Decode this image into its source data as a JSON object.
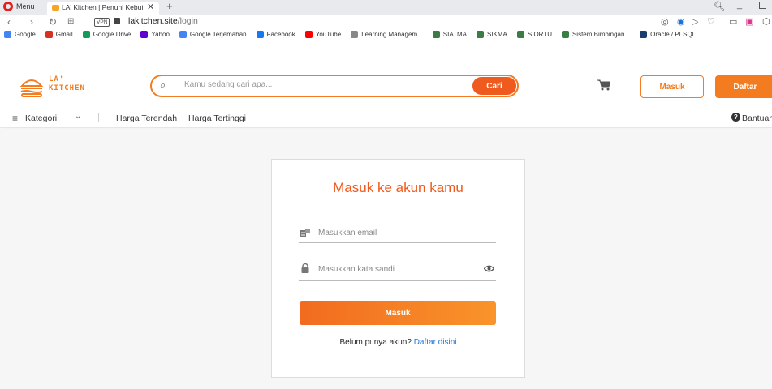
{
  "browser": {
    "menu_label": "Menu",
    "tab_title": "LA' Kitchen | Penuhi Kebutuh",
    "tab_close": "✕",
    "new_tab": "+",
    "vpn_badge": "VPN",
    "url_host": "lakitchen.site",
    "url_path": "/login",
    "bookmarks": [
      {
        "label": "Google",
        "icon": "google-icon",
        "color": "#4285f4"
      },
      {
        "label": "Gmail",
        "icon": "gmail-icon",
        "color": "#d93025"
      },
      {
        "label": "Google Drive",
        "icon": "drive-icon",
        "color": "#0f9d58"
      },
      {
        "label": "Yahoo",
        "icon": "yahoo-icon",
        "color": "#6001d2"
      },
      {
        "label": "Google Terjemahan",
        "icon": "translate-icon",
        "color": "#4285f4"
      },
      {
        "label": "Facebook",
        "icon": "facebook-icon",
        "color": "#1877f2"
      },
      {
        "label": "YouTube",
        "icon": "youtube-icon",
        "color": "#ff0000"
      },
      {
        "label": "Learning Managem...",
        "icon": "lms-icon",
        "color": "#888888"
      },
      {
        "label": "SIATMA",
        "icon": "atma-icon",
        "color": "#3a7d44"
      },
      {
        "label": "SIKMA",
        "icon": "atma-icon",
        "color": "#3a7d44"
      },
      {
        "label": "SIORTU",
        "icon": "atma-icon",
        "color": "#3a7d44"
      },
      {
        "label": "Sistem Bimbingan...",
        "icon": "atma-icon",
        "color": "#3a7d44"
      },
      {
        "label": "Oracle / PLSQL",
        "icon": "oracle-icon",
        "color": "#1a3d6e"
      }
    ]
  },
  "header": {
    "logo_line1": "LA'",
    "logo_line2": "KITCHEN",
    "search_placeholder": "Kamu sedang cari apa...",
    "search_button": "Cari",
    "login_button": "Masuk",
    "register_button": "Daftar"
  },
  "catbar": {
    "category_label": "Kategori",
    "price_low": "Harga Terendah",
    "price_high": "Harga Tertinggi",
    "help_label": "Bantuan"
  },
  "login": {
    "title": "Masuk ke akun kamu",
    "email_placeholder": "Masukkan email",
    "password_placeholder": "Masukkan kata sandi",
    "submit_label": "Masuk",
    "no_account_text": "Belum punya akun?",
    "register_link": "Daftar disini"
  },
  "colors": {
    "brand_orange": "#f47c20",
    "link_blue": "#1a73d8",
    "page_bg": "#f6f6f6"
  }
}
